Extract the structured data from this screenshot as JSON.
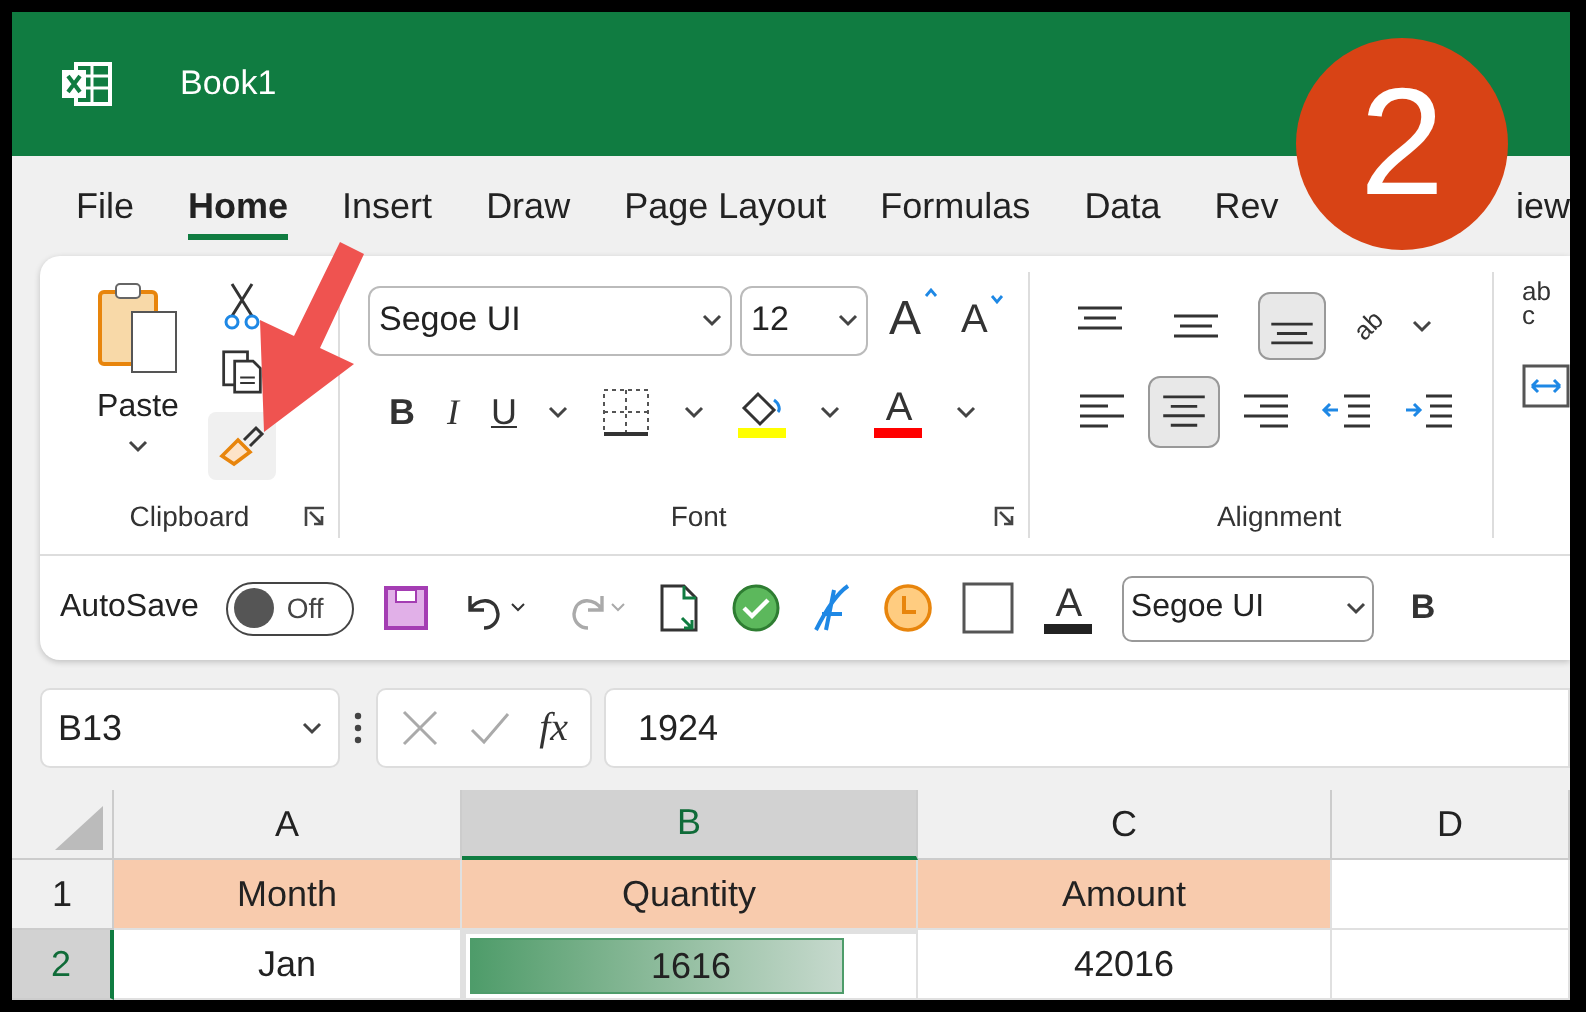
{
  "window": {
    "title": "Book1"
  },
  "step_badge": "2",
  "tabs": [
    {
      "label": "File",
      "selected": false
    },
    {
      "label": "Home",
      "selected": true
    },
    {
      "label": "Insert",
      "selected": false
    },
    {
      "label": "Draw",
      "selected": false
    },
    {
      "label": "Page Layout",
      "selected": false
    },
    {
      "label": "Formulas",
      "selected": false
    },
    {
      "label": "Data",
      "selected": false
    },
    {
      "label": "Rev",
      "selected": false
    },
    {
      "label": "iew",
      "selected": false
    }
  ],
  "ribbon": {
    "clipboard": {
      "paste": "Paste",
      "label": "Clipboard"
    },
    "font": {
      "name": "Segoe UI",
      "size": "12",
      "grow": "A",
      "shrink": "A",
      "bold": "B",
      "italic": "I",
      "underline": "U",
      "color_letter": "A",
      "label": "Font"
    },
    "alignment": {
      "orientation": "ab",
      "label": "Alignment"
    },
    "wrap": [
      "ab",
      "c"
    ]
  },
  "quick_access": {
    "autosave": "AutoSave",
    "toggle": {
      "label": "Off",
      "on": false
    },
    "text_color": "A",
    "font": "Segoe UI",
    "bold": "B"
  },
  "formula_bar": {
    "name_box": "B13",
    "fx": "fx",
    "value": "1924"
  },
  "grid": {
    "columns": [
      {
        "label": "A",
        "selected": false
      },
      {
        "label": "B",
        "selected": true
      },
      {
        "label": "C",
        "selected": false
      },
      {
        "label": "D",
        "selected": false
      }
    ],
    "rows": [
      {
        "header": "1",
        "selected": false,
        "cells": [
          {
            "text": "Month"
          },
          {
            "text": "Quantity"
          },
          {
            "text": "Amount"
          }
        ]
      },
      {
        "header": "2",
        "selected": true,
        "cells": [
          {
            "text": "Jan"
          },
          {
            "text": "1616",
            "level": 0.83
          },
          {
            "text": "42016"
          }
        ]
      }
    ]
  }
}
